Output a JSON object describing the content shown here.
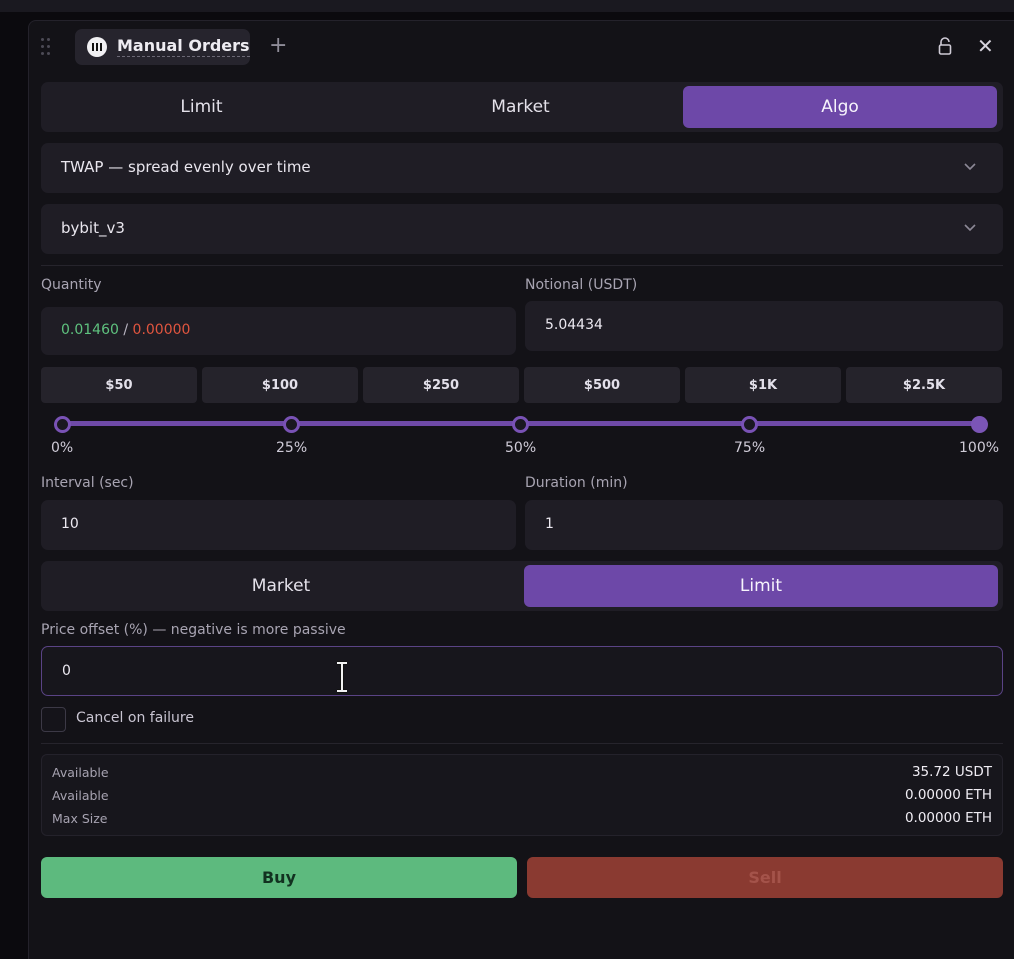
{
  "window": {
    "tab_title": "Manual Orders",
    "add_tab_symbol": "+",
    "close_symbol": "✕"
  },
  "order_type_tabs": [
    {
      "label": "Limit",
      "active": false
    },
    {
      "label": "Market",
      "active": false
    },
    {
      "label": "Algo",
      "active": true
    }
  ],
  "algo_select": {
    "value": "TWAP — spread evenly over time"
  },
  "exchange_select": {
    "value": "bybit_v3"
  },
  "quantity": {
    "label": "Quantity",
    "buy_value": "0.01460",
    "separator": "/",
    "sell_value": "0.00000"
  },
  "notional": {
    "label": "Notional (USDT)",
    "value": "5.04434"
  },
  "presets": [
    "$50",
    "$100",
    "$250",
    "$500",
    "$1K",
    "$2.5K"
  ],
  "slider": {
    "value_fraction": 1.0,
    "marks": [
      "0%",
      "25%",
      "50%",
      "75%",
      "100%"
    ]
  },
  "interval": {
    "label": "Interval (sec)",
    "value": "10"
  },
  "duration": {
    "label": "Duration (min)",
    "value": "1"
  },
  "execution_tabs": [
    {
      "label": "Market",
      "active": false
    },
    {
      "label": "Limit",
      "active": true
    }
  ],
  "price_offset": {
    "label": "Price offset (%) — negative is more passive",
    "value": "0"
  },
  "cancel_on_failure": {
    "label": "Cancel on failure",
    "checked": false
  },
  "summary": [
    {
      "label": "Available",
      "value": "35.72 USDT"
    },
    {
      "label": "Available",
      "value": "0.00000 ETH"
    },
    {
      "label": "Max Size",
      "value": "0.00000 ETH"
    }
  ],
  "actions": {
    "buy_label": "Buy",
    "sell_label": "Sell"
  },
  "colors": {
    "accent": "#6d48a8",
    "buy": "#5dba7e",
    "sell": "#8a3a31",
    "qty_buy": "#5fc27f",
    "qty_sell": "#e0553f"
  }
}
